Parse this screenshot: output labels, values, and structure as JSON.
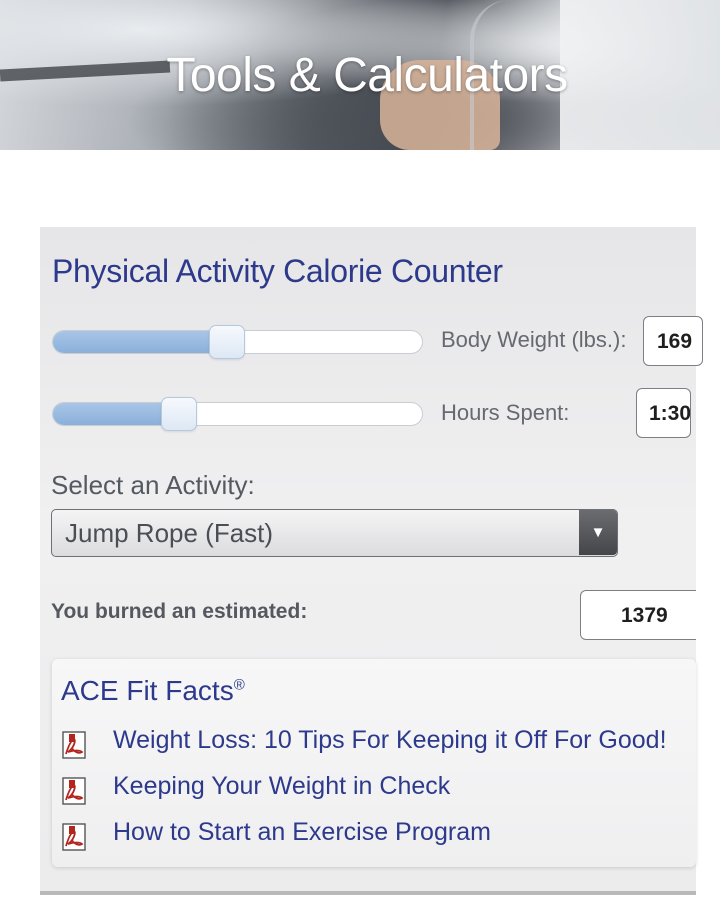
{
  "header": {
    "title": "Tools & Calculators"
  },
  "calculator": {
    "title": "Physical Activity Calorie Counter",
    "body_weight": {
      "label": "Body Weight (lbs.):",
      "value": "169",
      "slider_level": 0.47
    },
    "hours_spent": {
      "label": "Hours Spent:",
      "value": "1:30",
      "slider_level": 0.34
    },
    "activity": {
      "label": "Select an Activity:",
      "selected": "Jump Rope (Fast)",
      "arrow": "▼"
    },
    "result": {
      "label": "You burned an estimated:",
      "value": "1379"
    }
  },
  "fit_facts": {
    "title": "ACE Fit Facts",
    "mark": "®",
    "links": [
      {
        "label": "Weight Loss: 10 Tips For Keeping it Off For Good!",
        "icon": "pdf-icon"
      },
      {
        "label": "Keeping Your Weight in Check",
        "icon": "pdf-icon"
      },
      {
        "label": "How to Start an Exercise Program",
        "icon": "pdf-icon"
      }
    ]
  },
  "colors": {
    "accent": "#2d3a8c",
    "slider_fill": "#8ab0db",
    "pdf_red": "#b3261e"
  }
}
